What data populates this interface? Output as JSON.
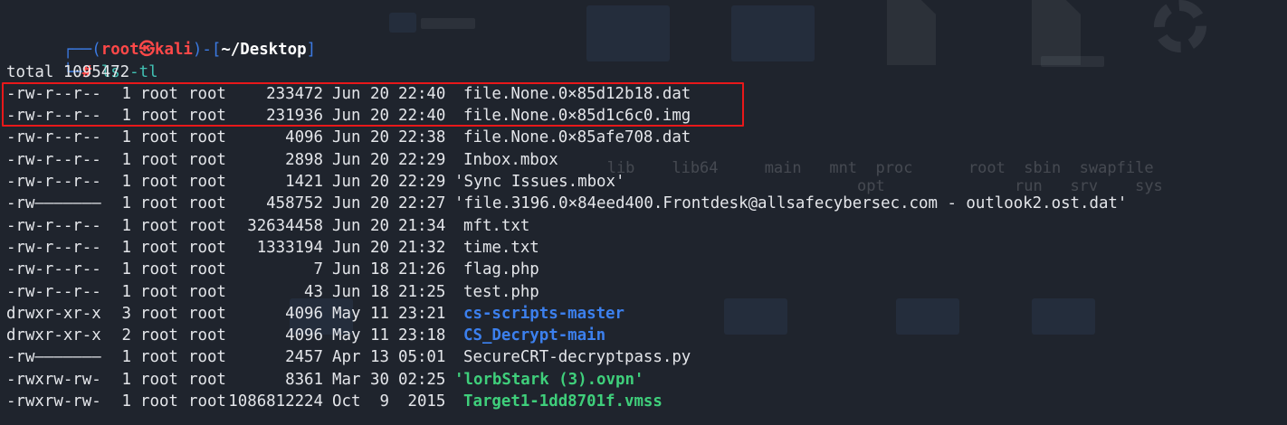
{
  "prompt": {
    "open_corner": "┌──(",
    "user": "root",
    "at_symbol": "㉿",
    "host": "kali",
    "mid": ")-[",
    "cwd": "~/Desktop",
    "close": "]",
    "cmd_corner": "└─",
    "hash": "#",
    "command": "ls -tl"
  },
  "total_line": "total 1095472",
  "files": [
    {
      "perm": "-rw-r--r--",
      "links": "1",
      "owner": "root",
      "group": "root",
      "size": "233472",
      "month": "Jun",
      "day": "20",
      "time": "22:40",
      "name": "file.None.0×85d12b18.dat",
      "kind": "plain"
    },
    {
      "perm": "-rw-r--r--",
      "links": "1",
      "owner": "root",
      "group": "root",
      "size": "231936",
      "month": "Jun",
      "day": "20",
      "time": "22:40",
      "name": "file.None.0×85d1c6c0.img",
      "kind": "plain"
    },
    {
      "perm": "-rw-r--r--",
      "links": "1",
      "owner": "root",
      "group": "root",
      "size": "4096",
      "month": "Jun",
      "day": "20",
      "time": "22:38",
      "name": "file.None.0×85afe708.dat",
      "kind": "plain"
    },
    {
      "perm": "-rw-r--r--",
      "links": "1",
      "owner": "root",
      "group": "root",
      "size": "2898",
      "month": "Jun",
      "day": "20",
      "time": "22:29",
      "name": "Inbox.mbox",
      "kind": "plain"
    },
    {
      "perm": "-rw-r--r--",
      "links": "1",
      "owner": "root",
      "group": "root",
      "size": "1421",
      "month": "Jun",
      "day": "20",
      "time": "22:29",
      "name": "'Sync Issues.mbox'",
      "kind": "quoted"
    },
    {
      "perm": "-rw———————",
      "links": "1",
      "owner": "root",
      "group": "root",
      "size": "458752",
      "month": "Jun",
      "day": "20",
      "time": "22:27",
      "name": "'file.3196.0×84eed400.Frontdesk@allsafecybersec.com - outlook2.ost.dat'",
      "kind": "quoted"
    },
    {
      "perm": "-rw-r--r--",
      "links": "1",
      "owner": "root",
      "group": "root",
      "size": "32634458",
      "month": "Jun",
      "day": "20",
      "time": "21:34",
      "name": "mft.txt",
      "kind": "plain"
    },
    {
      "perm": "-rw-r--r--",
      "links": "1",
      "owner": "root",
      "group": "root",
      "size": "1333194",
      "month": "Jun",
      "day": "20",
      "time": "21:32",
      "name": "time.txt",
      "kind": "plain"
    },
    {
      "perm": "-rw-r--r--",
      "links": "1",
      "owner": "root",
      "group": "root",
      "size": "7",
      "month": "Jun",
      "day": "18",
      "time": "21:26",
      "name": "flag.php",
      "kind": "plain"
    },
    {
      "perm": "-rw-r--r--",
      "links": "1",
      "owner": "root",
      "group": "root",
      "size": "43",
      "month": "Jun",
      "day": "18",
      "time": "21:25",
      "name": "test.php",
      "kind": "plain"
    },
    {
      "perm": "drwxr-xr-x",
      "links": "3",
      "owner": "root",
      "group": "root",
      "size": "4096",
      "month": "May",
      "day": "11",
      "time": "23:21",
      "name": "cs-scripts-master",
      "kind": "dir"
    },
    {
      "perm": "drwxr-xr-x",
      "links": "2",
      "owner": "root",
      "group": "root",
      "size": "4096",
      "month": "May",
      "day": "11",
      "time": "23:18",
      "name": "CS_Decrypt-main",
      "kind": "dir"
    },
    {
      "perm": "-rw———————",
      "links": "1",
      "owner": "root",
      "group": "root",
      "size": "2457",
      "month": "Apr",
      "day": "13",
      "time": "05:01",
      "name": "SecureCRT-decryptpass.py",
      "kind": "plain"
    },
    {
      "perm": "-rwxrw-rw-",
      "links": "1",
      "owner": "root",
      "group": "root",
      "size": "8361",
      "month": "Mar",
      "day": "30",
      "time": "02:25",
      "name": "'lorbStark (3).ovpn'",
      "kind": "exec"
    },
    {
      "perm": "-rwxrw-rw-",
      "links": "1",
      "owner": "root",
      "group": "root",
      "size": "1086812224",
      "month": "Oct",
      "day": "9",
      "time": " 2015",
      "name": "Target1-1dd8701f.vmss",
      "kind": "exec"
    }
  ],
  "colors": {
    "background": "#1f242d",
    "prompt_blue": "#3b7ae2",
    "user_red": "#ff4848",
    "command_teal": "#41c0b3",
    "exec_green": "#3fcf7b",
    "dir_blue": "#3c80ee",
    "highlight_red": "#e8181a"
  }
}
